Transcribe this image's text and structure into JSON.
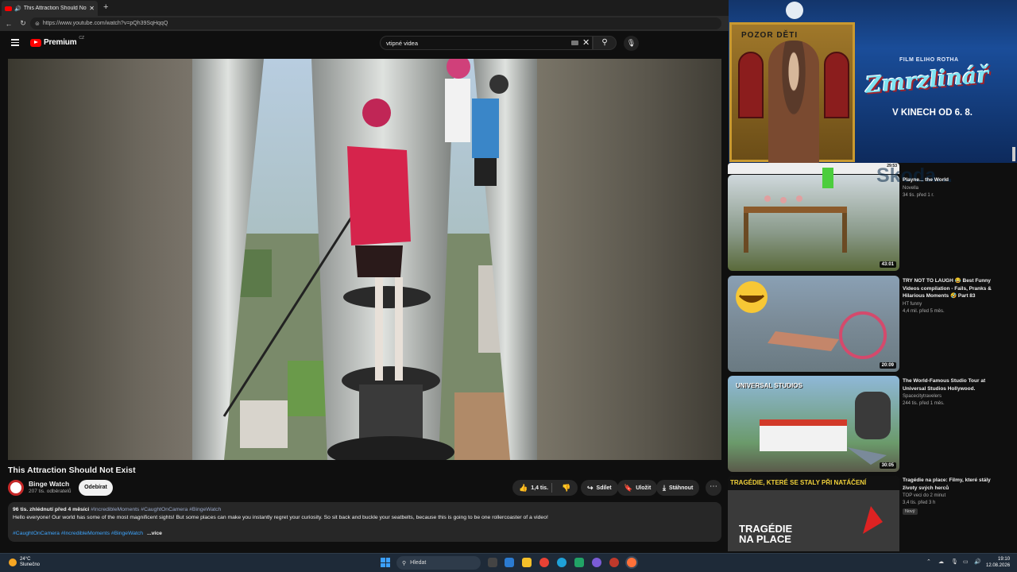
{
  "browser": {
    "tab_title": "This Attraction Should Not Exist",
    "tab_close": "✕",
    "new_tab": "+",
    "url": "https://www.youtube.com/watch?v=pQh39SqHqqQ",
    "back": "←",
    "reload": "↻"
  },
  "header": {
    "logo": "Premium",
    "region": "CZ",
    "search_value": "vtipné videa",
    "clear": "✕",
    "search_icon": "⚲",
    "mic_icon": "🎙"
  },
  "video": {
    "title": "This Attraction Should Not Exist",
    "channel": "Binge Watch",
    "subscribers": "207 tis. odběratelů",
    "subscribe_label": "Odebírat",
    "likes": "1,4 tis.",
    "share_label": "Sdílet",
    "save_label": "Uložit",
    "download_label": "Stáhnout",
    "more": "⋯",
    "views_date": "96 tis. zhlédnutí  před 4 měsíci",
    "tags_top": "#IncredibleMoments #CaughtOnCamera #BingeWatch",
    "description": "Hello everyone! Our world has some of the most magnificent sights! But some places can make you instantly regret your curiosity. So sit back and buckle your seatbelts, because this is going to be one rollercoaster of a video!",
    "tags_bottom": "#CaughtOnCamera #IncredibleMoments #BingeWatch",
    "more_label": "...více"
  },
  "ad": {
    "sign_text": "POZOR DĚTI",
    "film_label": "FILM ELIHO ROTHA",
    "brand": "Zmrzlinář",
    "date": "V KINECH OD 6. 8.",
    "overlay_text": "Skoda..."
  },
  "recommendations": [
    {
      "title": "Pl​ayne... the World",
      "channel": "Novella",
      "stats": "34 tis.  před 1 r.",
      "duration": "43:01",
      "top_duration": "29:53"
    },
    {
      "title": "TRY NOT TO LAUGH 😂 Best Funny Videos compilation - Fails, Pranks & Hilarious Moments 🤣 Part 83",
      "channel": "HT funny",
      "stats": "4,4 mil.  před 5 měs.",
      "duration": "20:09"
    },
    {
      "title": "The World-Famous Studio Tour at Universal Studios Hollywood.",
      "channel": "Spacecitytravelers",
      "stats": "244 tis.  před 1 měs.",
      "duration": "30:05",
      "thumb_text": "UNIVERSAL STUDIOS"
    },
    {
      "title": "Tragédie na place: Filmy, které stály životy svých herců",
      "channel": "TOP veci do 2 minut",
      "stats": "3,4 tis.  před 3 h",
      "badge": "Nový",
      "thumb_text_top": "TRAGÉDIE, KTERÉ SE STALY PŘI NATÁČENÍ",
      "thumb_text_bottom": "TRAGÉDIE NA PLACE"
    }
  ],
  "taskbar": {
    "temp": "24°C",
    "weather": "Slunečno",
    "search_label": "Hledat",
    "time": "19:10",
    "date": "12.08.2026"
  },
  "colors": {
    "yt_red": "#ff0000",
    "link_blue": "#3ea6ff",
    "bg": "#0f0f0f"
  }
}
